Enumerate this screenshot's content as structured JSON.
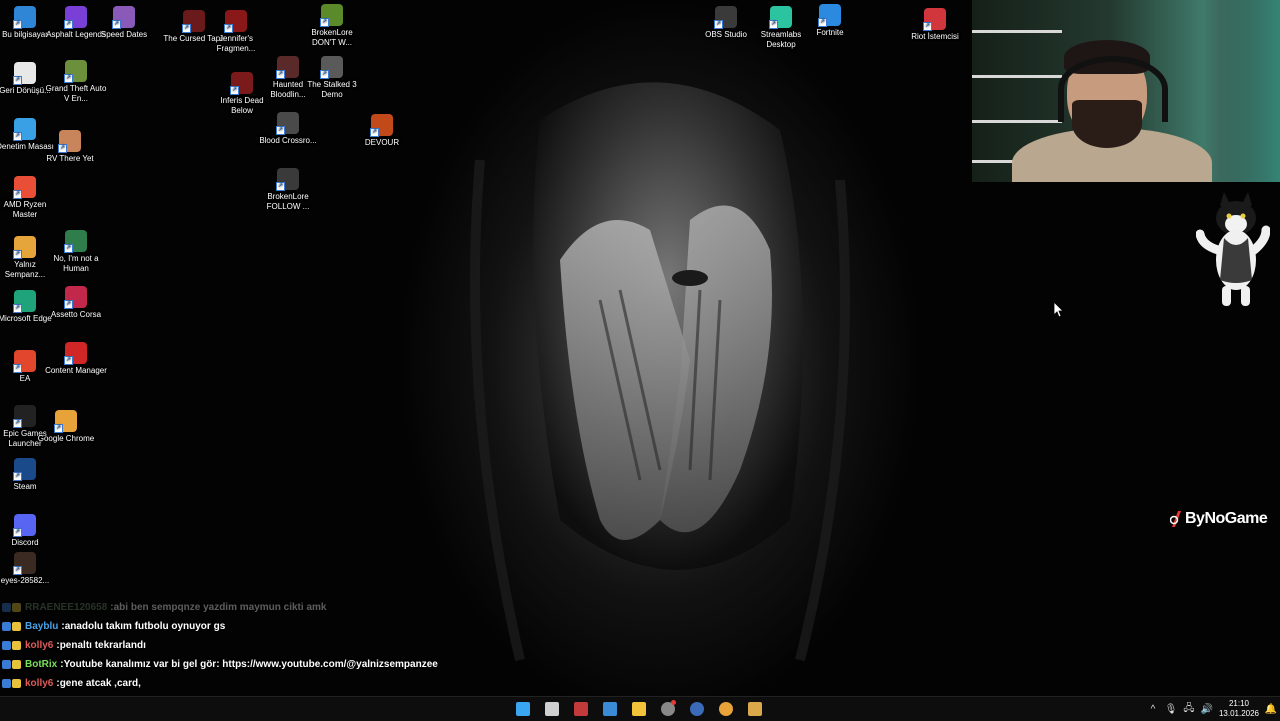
{
  "desktop_icons": [
    {
      "label": "Bu bilgisayar",
      "icon": "computer-icon",
      "color": "#2f86d6"
    },
    {
      "label": "Geri Dönüşü...",
      "icon": "recycle-bin-icon",
      "color": "#e8e8e8"
    },
    {
      "label": "Denetim Masası",
      "icon": "control-panel-icon",
      "color": "#3aa0e6"
    },
    {
      "label": "AMD Ryzen Master",
      "icon": "amd-ryzen-icon",
      "color": "#e94f37"
    },
    {
      "label": "Yalnız Sempanz...",
      "icon": "chrome-profile-icon",
      "color": "#e6a53a"
    },
    {
      "label": "Microsoft Edge",
      "icon": "edge-icon",
      "color": "#1fa37a"
    },
    {
      "label": "EA",
      "icon": "ea-icon",
      "color": "#e2472e"
    },
    {
      "label": "Epic Games Launcher",
      "icon": "epic-games-icon",
      "color": "#222222"
    },
    {
      "label": "Steam",
      "icon": "steam-icon",
      "color": "#1b4a8a"
    },
    {
      "label": "Discord",
      "icon": "discord-icon",
      "color": "#5865f2"
    },
    {
      "label": "eyes-28582...",
      "icon": "image-file-icon",
      "color": "#3a2a22"
    },
    {
      "label": "Asphalt Legends",
      "icon": "asphalt-icon",
      "color": "#7a3fd6"
    },
    {
      "label": "Grand Theft Auto V En...",
      "icon": "gta-icon",
      "color": "#6b8f3a"
    },
    {
      "label": "RV There Yet",
      "icon": "rv-there-yet-icon",
      "color": "#c8845a"
    },
    {
      "label": "No, I'm not a Human",
      "icon": "not-human-icon",
      "color": "#2f7d4a"
    },
    {
      "label": "Assetto Corsa",
      "icon": "assetto-corsa-icon",
      "color": "#c2284a"
    },
    {
      "label": "Content Manager",
      "icon": "content-manager-icon",
      "color": "#d12626"
    },
    {
      "label": "Google Chrome",
      "icon": "chrome-icon",
      "color": "#e8a23a"
    },
    {
      "label": "Speed Dates",
      "icon": "speed-dates-icon",
      "color": "#8a5ab8"
    },
    {
      "label": "The Cursed Tape",
      "icon": "cursed-tape-icon",
      "color": "#6a1a1a"
    },
    {
      "label": "Jennifer's Fragmen...",
      "icon": "jennifers-fragment-icon",
      "color": "#8a1818"
    },
    {
      "label": "Inferis Dead Below",
      "icon": "inferis-icon",
      "color": "#7a1a1a"
    },
    {
      "label": "BrokenLore DON'T W...",
      "icon": "brokenlore-dont-watch-icon",
      "color": "#5a8a2a"
    },
    {
      "label": "Haunted Bloodlin...",
      "icon": "haunted-bloodlines-icon",
      "color": "#5a2a2a"
    },
    {
      "label": "The Stalked 3 Demo",
      "icon": "stalked-icon",
      "color": "#5a5a5a"
    },
    {
      "label": "Blood Crossro...",
      "icon": "blood-crossroads-icon",
      "color": "#4a4a4a"
    },
    {
      "label": "BrokenLore FOLLOW ...",
      "icon": "brokenlore-follow-icon",
      "color": "#3a3a3a"
    },
    {
      "label": "DEVOUR",
      "icon": "devour-icon",
      "color": "#c24a1a"
    },
    {
      "label": "OBS Studio",
      "icon": "obs-icon",
      "color": "#3a3a3a"
    },
    {
      "label": "Streamlabs Desktop",
      "icon": "streamlabs-icon",
      "color": "#2bc3a0"
    },
    {
      "label": "Fortnite",
      "icon": "fortnite-icon",
      "color": "#2b8ae0"
    },
    {
      "label": "Riot İstemcisi",
      "icon": "riot-client-icon",
      "color": "#d1363d"
    }
  ],
  "brand": "ByNoGame",
  "chat": [
    {
      "user": "RRAENEE120658",
      "message": "abi ben sempqnze yazdim maymun cikti amk",
      "user_color": "#6a8a6a",
      "faded": true
    },
    {
      "user": "Bayblu",
      "message": "anadolu takım futbolu oynuyor gs",
      "user_color": "#4aa3e8",
      "faded": false
    },
    {
      "user": "kolly6",
      "message": "penaltı tekrarlandı",
      "user_color": "#e05a5a",
      "faded": false
    },
    {
      "user": "BotRix",
      "message": "Youtube kanalımız var bi gel gör: https://www.youtube.com/@yalnizsempanzee",
      "user_color": "#7be05a",
      "faded": false
    },
    {
      "user": "kolly6",
      "message": "gene atcak ,card,",
      "user_color": "#e05a5a",
      "faded": false
    }
  ],
  "taskbar": {
    "apps": [
      {
        "name": "start-button",
        "icon": "windows-icon",
        "color": "#3aa6f0"
      },
      {
        "name": "task-view-button",
        "icon": "task-view-icon",
        "color": "#d0d0d0"
      },
      {
        "name": "taskbar-app-1",
        "icon": "pinned-app-icon",
        "color": "#c23a3a"
      },
      {
        "name": "taskbar-app-2",
        "icon": "photos-icon",
        "color": "#3a8ad6"
      },
      {
        "name": "taskbar-file-explorer",
        "icon": "folder-icon",
        "color": "#f2c23a"
      },
      {
        "name": "taskbar-obs",
        "icon": "obs-icon",
        "color": "#888888"
      },
      {
        "name": "taskbar-steam",
        "icon": "steam-icon",
        "color": "#3a6ab8"
      },
      {
        "name": "taskbar-chrome",
        "icon": "chrome-icon",
        "color": "#e8a23a"
      },
      {
        "name": "taskbar-app-3",
        "icon": "app-icon",
        "color": "#d8a84a"
      }
    ],
    "tray": {
      "chevron": "^",
      "mic": "🎙",
      "network": "🖧",
      "volume": "🔊",
      "time": "21:10",
      "date": "13.01.2026",
      "notification": "🔔"
    }
  },
  "colors": {
    "taskbar_bg": "#0d0d0d",
    "desktop_bg": "#000000"
  }
}
